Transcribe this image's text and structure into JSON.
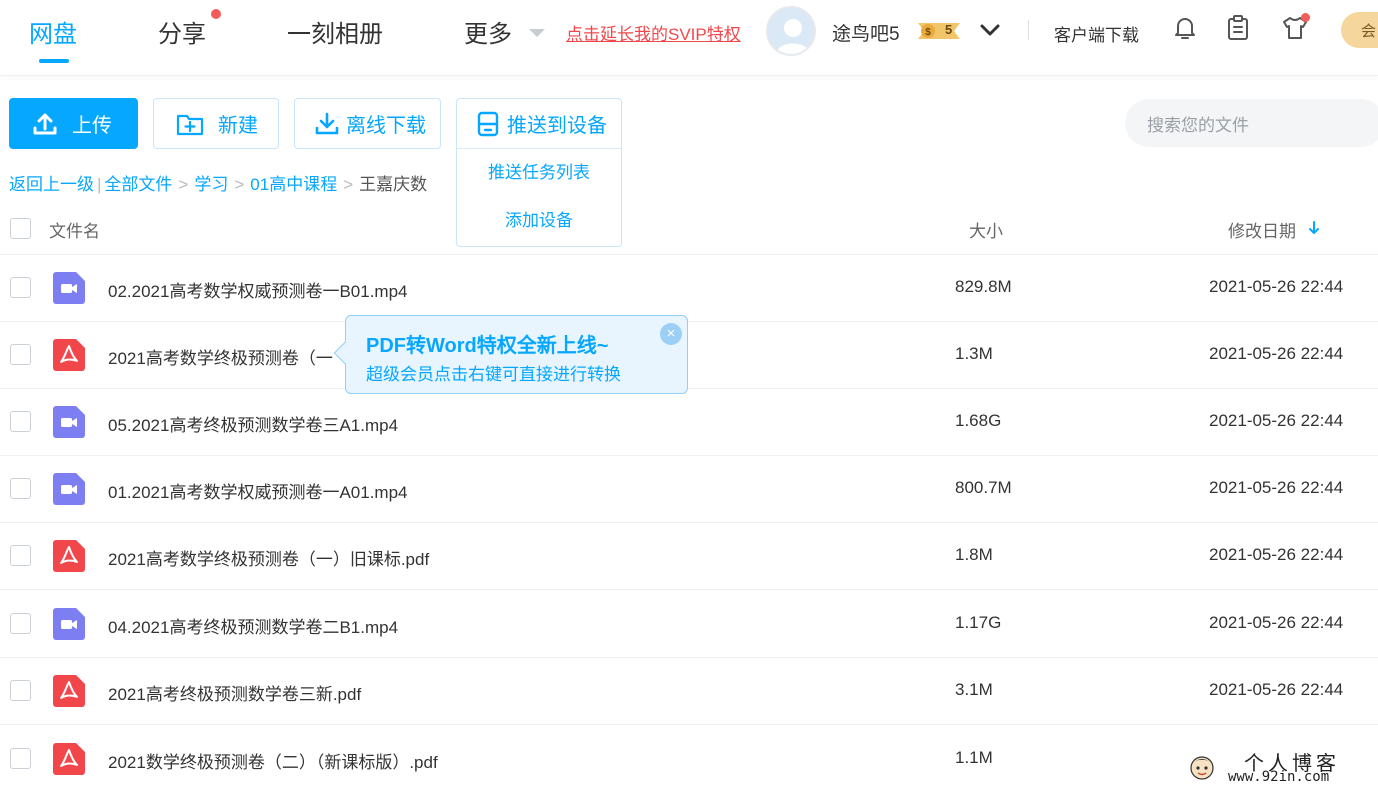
{
  "nav": {
    "tabs": [
      {
        "label": "网盘",
        "active": true
      },
      {
        "label": "分享",
        "has_dot": true
      },
      {
        "label": "一刻相册"
      },
      {
        "label": "更多"
      }
    ],
    "svip_link": "点击延长我的SVIP特权",
    "username": "途鸟吧5",
    "svip_badge": "5",
    "client_download": "客户端下载",
    "member_pill": "会",
    "icons": [
      "bell-icon",
      "clipboard-icon",
      "tshirt-icon"
    ],
    "accent_color": "#06a7ff",
    "alert_color": "#f45b5b"
  },
  "toolbar": {
    "upload": "上传",
    "new": "新建",
    "offline_download": "离线下载",
    "push_to_device": "推送到设备",
    "push_menu": [
      "推送任务列表",
      "添加设备"
    ],
    "search_placeholder": "搜索您的文件"
  },
  "breadcrumb": {
    "back": "返回上一级",
    "items": [
      "全部文件",
      "学习",
      "01高中课程"
    ],
    "current": "王嘉庆数"
  },
  "table": {
    "columns": {
      "name": "文件名",
      "size": "大小",
      "date": "修改日期"
    },
    "rows": [
      {
        "type": "video",
        "name": "02.2021高考数学权威预测卷一B01.mp4",
        "size": "829.8M",
        "date": "2021-05-26 22:44"
      },
      {
        "type": "pdf",
        "name": "2021高考数学终极预测卷（一",
        "size": "1.3M",
        "date": "2021-05-26 22:44"
      },
      {
        "type": "video",
        "name": "05.2021高考终极预测数学卷三A1.mp4",
        "size": "1.68G",
        "date": "2021-05-26 22:44"
      },
      {
        "type": "video",
        "name": "01.2021高考数学权威预测卷一A01.mp4",
        "size": "800.7M",
        "date": "2021-05-26 22:44"
      },
      {
        "type": "pdf",
        "name": "2021高考数学终极预测卷（一）旧课标.pdf",
        "size": "1.8M",
        "date": "2021-05-26 22:44"
      },
      {
        "type": "video",
        "name": "04.2021高考终极预测数学卷二B1.mp4",
        "size": "1.17G",
        "date": "2021-05-26 22:44"
      },
      {
        "type": "pdf",
        "name": "2021高考终极预测数学卷三新.pdf",
        "size": "3.1M",
        "date": "2021-05-26 22:44"
      },
      {
        "type": "pdf",
        "name": "2021数学终极预测卷（二）（新课标版）.pdf",
        "size": "1.1M",
        "date": ""
      }
    ],
    "video_icon_color": "#7d7ef2",
    "pdf_icon_color": "#f2474a"
  },
  "tooltip": {
    "title": "PDF转Word特权全新上线~",
    "subtitle": "超级会员点击右键可直接进行转换",
    "close": "×"
  },
  "watermark": {
    "title": "个人博客",
    "url": "www.92in.com"
  }
}
